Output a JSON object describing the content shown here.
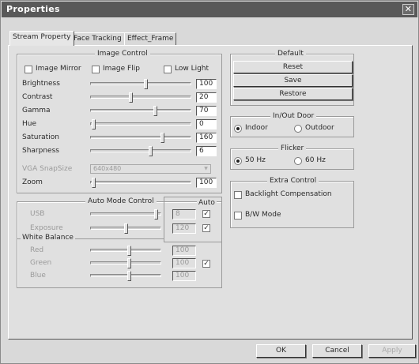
{
  "window": {
    "title": "Properties",
    "close_glyph": "✕"
  },
  "tabs": [
    "Stream Property",
    "Face Tracking",
    "Effect_Frame"
  ],
  "image_control": {
    "title": "Image Control",
    "checkboxes": [
      {
        "label": "Image Mirror",
        "checked": false
      },
      {
        "label": "Image Flip",
        "checked": false
      },
      {
        "label": "Low Light",
        "checked": false
      }
    ],
    "sliders": [
      {
        "label": "Brightness",
        "value": "100",
        "level": 0.55
      },
      {
        "label": "Contrast",
        "value": "20",
        "level": 0.4
      },
      {
        "label": "Gamma",
        "value": "70",
        "level": 0.65
      },
      {
        "label": "Hue",
        "value": "0",
        "level": 0.02
      },
      {
        "label": "Saturation",
        "value": "160",
        "level": 0.72
      },
      {
        "label": "Sharpness",
        "value": "6",
        "level": 0.6
      }
    ],
    "vga_label": "VGA SnapSize",
    "vga_value": "640x480",
    "zoom": {
      "label": "Zoom",
      "value": "100",
      "level": 0.02
    }
  },
  "auto_mode": {
    "title": "Auto Mode Control",
    "auto_header": "Auto",
    "rows": [
      {
        "label": "USB",
        "value": "8",
        "level": 0.95,
        "auto": true
      },
      {
        "label": "Exposure",
        "value": "120",
        "level": 0.5,
        "auto": true
      }
    ],
    "white_balance_title": "White Balance",
    "wb_rows": [
      {
        "label": "Red",
        "value": "100",
        "level": 0.55
      },
      {
        "label": "Green",
        "value": "100",
        "level": 0.55
      },
      {
        "label": "Blue",
        "value": "100",
        "level": 0.55
      }
    ],
    "wb_auto": true
  },
  "default": {
    "title": "Default",
    "buttons": [
      "Reset",
      "Save",
      "Restore"
    ]
  },
  "inout": {
    "title": "In/Out Door",
    "options": [
      {
        "label": "Indoor",
        "on": true
      },
      {
        "label": "Outdoor",
        "on": false
      }
    ]
  },
  "flicker": {
    "title": "Flicker",
    "options": [
      {
        "label": "50 Hz",
        "on": true
      },
      {
        "label": "60 Hz",
        "on": false
      }
    ]
  },
  "extra": {
    "title": "Extra Control",
    "checkboxes": [
      {
        "label": "Backlight Compensation",
        "checked": false
      },
      {
        "label": "B/W Mode",
        "checked": false
      }
    ]
  },
  "footer": {
    "ok": "OK",
    "cancel": "Cancel",
    "apply": "Apply"
  },
  "check_glyph": "✓"
}
